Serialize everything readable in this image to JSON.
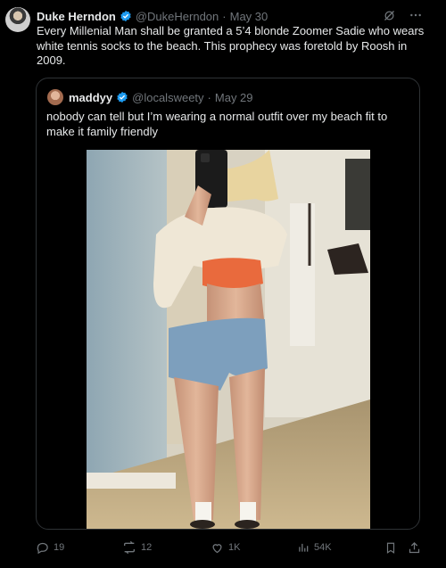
{
  "tweet": {
    "author_name": "Duke Herndon",
    "handle": "@DukeHerndon",
    "separator": "·",
    "date": "May 30",
    "text": "Every Millenial Man shall be granted a 5’4 blonde Zoomer Sadie who wears white tennis socks to the beach. This prophecy was foretold by Roosh in 2009."
  },
  "quoted": {
    "author_name": "maddyy",
    "handle": "@localsweety",
    "separator": "·",
    "date": "May 29",
    "text": "nobody can tell but I’m wearing a normal outfit over my beach fit to make it family friendly"
  },
  "actions": {
    "replies": "19",
    "reposts": "12",
    "likes": "1K",
    "views": "54K"
  },
  "icons": {
    "header": [
      "grok-icon",
      "more-icon"
    ],
    "actions": [
      "reply-icon",
      "repost-icon",
      "like-icon",
      "views-icon",
      "bookmark-icon",
      "share-icon"
    ]
  },
  "colors": {
    "background": "#000000",
    "text": "#e7e9ea",
    "muted": "#71767b",
    "verified": "#1d9bf0",
    "border": "#2f3336"
  }
}
